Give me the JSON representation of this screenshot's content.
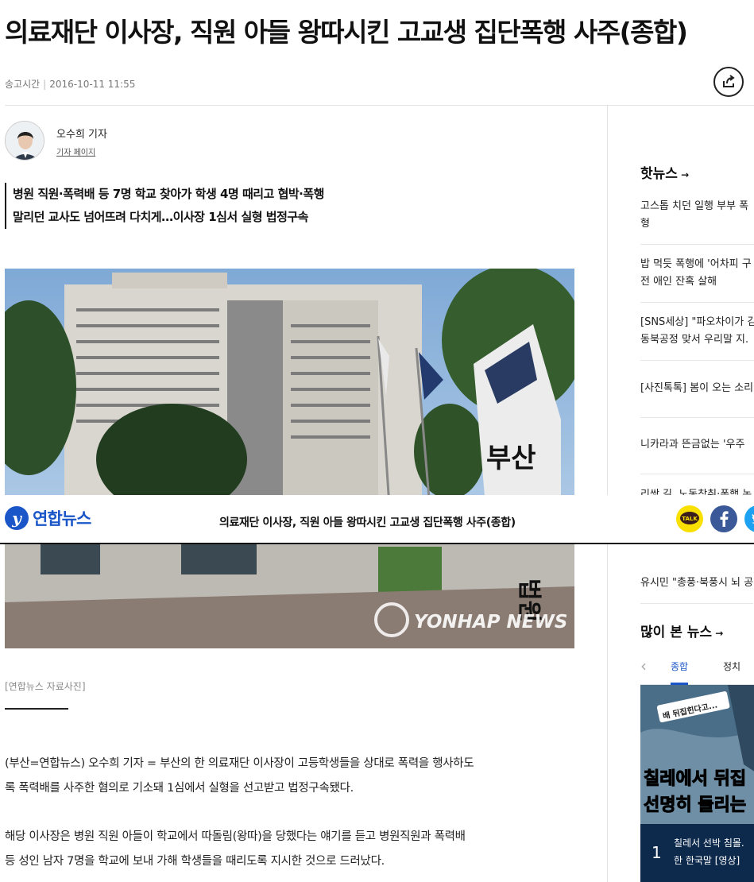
{
  "article": {
    "headline": "의료재단 이사장, 직원 아들 왕따시킨 고교생 집단폭행 사주(종합)",
    "meta_label": "송고시간",
    "meta_time": "2016-10-11 11:55",
    "author_name": "오수희 기자",
    "author_page": "기자 페이지",
    "subheads": [
      "병원 직원·폭력배 등 7명 학교 찾아가 학생 4명 때리고 협박·폭행",
      "말리던 교사도 넘어뜨려 다치게…이사장 1심서 실형 법정구속"
    ],
    "photo_watermark": "YONHAP NEWS",
    "photo_sign_text": "부산",
    "photo_sign_text2": "법원",
    "caption": "[연합뉴스 자료사진]",
    "paragraphs": [
      [
        "(부산=연합뉴스) 오수희 기자 = 부산의 한 의료재단 이사장이 고등학생들을 상대로 폭력을 행사하도",
        "록 폭력배를 사주한 혐의로 기소돼 1심에서 실형을 선고받고 법정구속됐다."
      ],
      [
        "해당 이사장은 병원 직원 아들이 학교에서 따돌림(왕따)을 당했다는 얘기를 듣고 병원직원과 폭력배",
        "등 성인 남자 7명을 학교에 보내 가해 학생들을 때리도록 지시한 것으로 드러났다."
      ]
    ]
  },
  "sticky": {
    "logo_mark": "y",
    "logo_text": "연합뉴스",
    "title": "의료재단 이사장, 직원 아들 왕따시킨 고교생 집단폭행 사주(종합)",
    "kakao_label": "TALK"
  },
  "sidebar": {
    "hot_title": "핫뉴스",
    "hot_items": [
      [
        "고스톱 치던 일행 부부 폭",
        "형"
      ],
      [
        "밥 먹듯 폭행에 '어차피 구",
        "전 애인 잔혹 살해"
      ],
      [
        "[SNS세상] \"파오차이가 김",
        "동북공정 맞서 우리말 지."
      ],
      [
        "[사진톡톡] 봄이 오는 소리"
      ],
      [
        "니카라과 뜬금없는 '우주"
      ],
      [
        "리쌍 길, 노동착취·폭행 논"
      ]
    ],
    "hot_last": "유시민 \"총풍·북풍시 뇌 공",
    "popular_title": "많이 본 뉴스",
    "tabs": [
      "종합",
      "정치"
    ],
    "popular_img_text1": "칠레에서 뒤집",
    "popular_img_text2": "선명히 들리는",
    "popular_img_tag": "배 뒤집힌다고...",
    "popular_rank": "1",
    "popular_item": [
      "칠레서 선박 침몰.",
      "한 한국말 [영상]"
    ]
  },
  "colors": {
    "brand": "#1a56c8",
    "kakao": "#f9e000",
    "facebook": "#3b5998",
    "twitter": "#1da1f2"
  }
}
